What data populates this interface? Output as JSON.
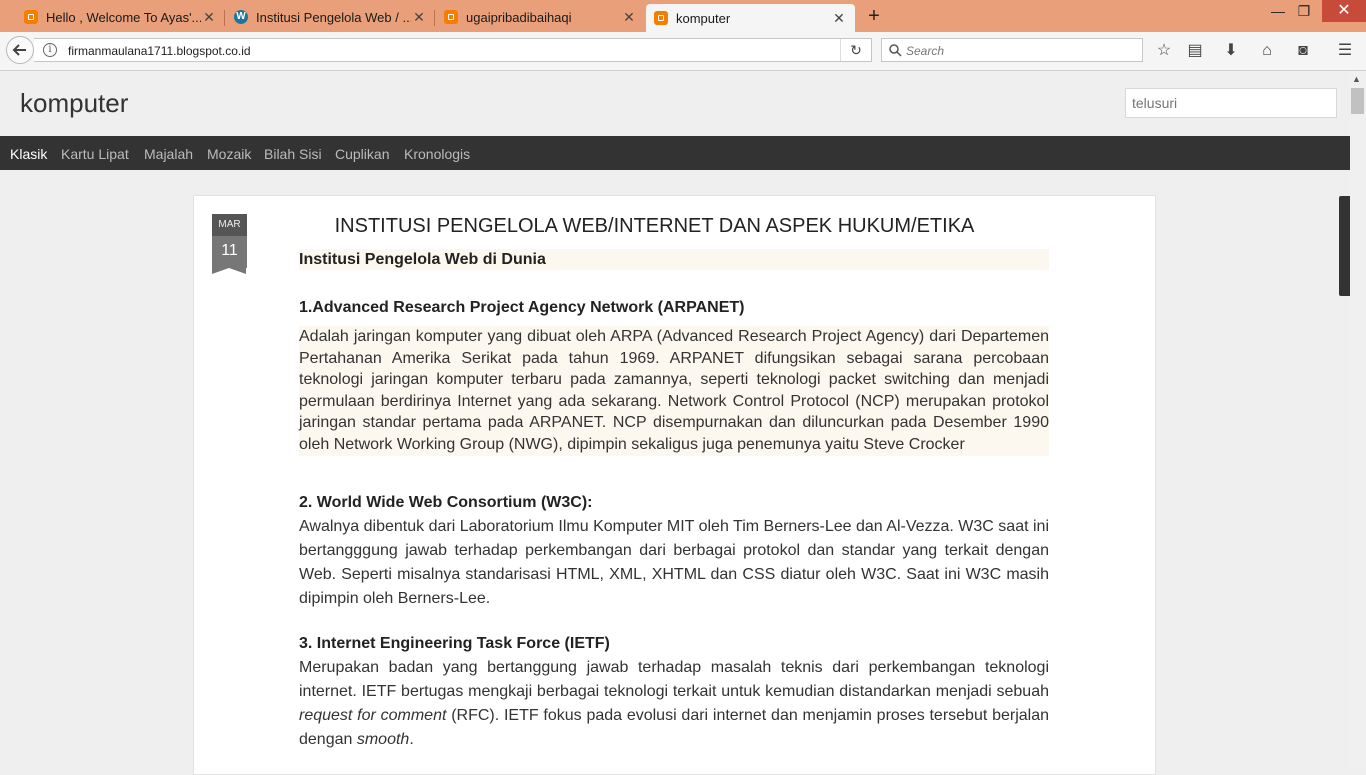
{
  "browser": {
    "tabs": [
      {
        "title": "Hello , Welcome To Ayas'...",
        "icon": "blogger-icon",
        "active": false
      },
      {
        "title": "Institusi Pengelola Web / ...",
        "icon": "wordpress-icon",
        "active": false
      },
      {
        "title": "ugaipribadibaihaqi",
        "icon": "blogger-icon",
        "active": false
      },
      {
        "title": "komputer",
        "icon": "blogger-icon",
        "active": true
      }
    ],
    "new_tab": "+",
    "url": "firmanmaulana1711.blogspot.co.id",
    "search_placeholder": "Search",
    "colors": {
      "tab_strip": "#e9a07a"
    }
  },
  "blog": {
    "title": "komputer",
    "search_placeholder": "telusuri",
    "views": [
      "Klasik",
      "Kartu Lipat",
      "Majalah",
      "Mozaik",
      "Bilah Sisi",
      "Cuplikan",
      "Kronologis"
    ],
    "selected_view": "Klasik"
  },
  "post": {
    "date_month": "MAR",
    "date_day": "11",
    "title": "INSTITUSI PENGELOLA WEB/INTERNET DAN ASPEK HUKUM/ETIKA",
    "subtitle": "Institusi Pengelola Web di Dunia",
    "sections": [
      {
        "heading": "1.Advanced Research Project Agency Network (ARPANET)",
        "body": "Adalah jaringan komputer yang dibuat oleh ARPA (Advanced Research Project Agency) dari Departemen Pertahanan Amerika Serikat pada tahun 1969. ARPANET difungsikan sebagai sarana percobaan teknologi jaringan komputer terbaru pada zamannya, seperti teknologi packet switching dan menjadi permulaan berdirinya Internet yang ada sekarang. Network Control Protocol (NCP) merupakan protokol jaringan standar pertama pada ARPANET. NCP disempurnakan dan diluncurkan pada Desember 1990 oleh Network Working Group (NWG), dipimpin sekaligus juga penemunya yaitu Steve Crocker"
      },
      {
        "heading": "2. World Wide Web Consortium (W3C):",
        "body": "Awalnya dibentuk dari Laboratorium Ilmu Komputer MIT oleh Tim Berners-Lee dan Al-Vezza. W3C saat ini bertangggung jawab terhadap perkembangan dari berbagai protokol dan standar yang terkait dengan Web. Seperti misalnya standarisasi HTML, XML, XHTML dan CSS diatur oleh W3C. Saat ini W3C masih dipimpin oleh Berners-Lee."
      },
      {
        "heading": "3. Internet Engineering Task Force (IETF)",
        "body_part1": "Merupakan badan yang bertanggung jawab terhadap masalah teknis dari perkembangan teknologi internet. IETF bertugas mengkaji berbagai teknologi terkait untuk kemudian distandarkan menjadi sebuah ",
        "body_italic1": "request for comment",
        "body_part2": " (RFC). IETF fokus pada evolusi dari internet dan menjamin proses tersebut berjalan dengan ",
        "body_italic2": "smooth",
        "body_part3": "."
      }
    ]
  }
}
